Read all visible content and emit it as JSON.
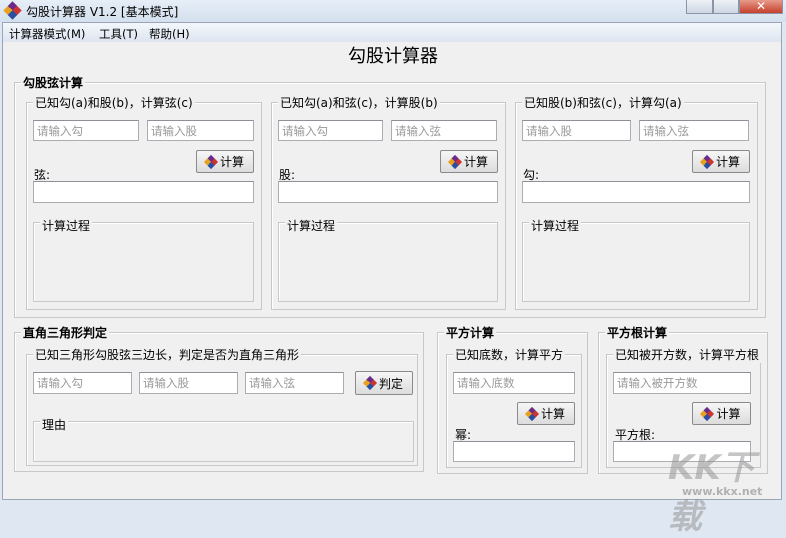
{
  "window": {
    "title": "勾股计算器 V1.2 [基本模式]",
    "close_label": "✕"
  },
  "menu": [
    "计算器模式(M)",
    "工具(T)",
    "帮助(H)"
  ],
  "main_title": "勾股计算器",
  "pythag": {
    "title": "勾股弦计算",
    "panels": [
      {
        "title": "已知勾(a)和股(b)，计算弦(c)",
        "ph1": "请输入勾",
        "ph2": "请输入股",
        "button": "计算",
        "result_label": "弦:",
        "process_label": "计算过程"
      },
      {
        "title": "已知勾(a)和弦(c)，计算股(b)",
        "ph1": "请输入勾",
        "ph2": "请输入弦",
        "button": "计算",
        "result_label": "股:",
        "process_label": "计算过程"
      },
      {
        "title": "已知股(b)和弦(c)，计算勾(a)",
        "ph1": "请输入股",
        "ph2": "请输入弦",
        "button": "计算",
        "result_label": "勾:",
        "process_label": "计算过程"
      }
    ]
  },
  "right_triangle": {
    "title": "直角三角形判定",
    "subtitle": "已知三角形勾股弦三边长，判定是否为直角三角形",
    "ph1": "请输入勾",
    "ph2": "请输入股",
    "ph3": "请输入弦",
    "button": "判定",
    "reason_label": "理由"
  },
  "square": {
    "title": "平方计算",
    "subtitle": "已知底数，计算平方",
    "placeholder": "请输入底数",
    "button": "计算",
    "result_label": "幂:"
  },
  "sqrt": {
    "title": "平方根计算",
    "subtitle": "已知被开方数，计算平方根",
    "placeholder": "请输入被开方数",
    "button": "计算",
    "result_label": "平方根:"
  },
  "watermark": {
    "logo": "KK下载",
    "url": "www.kkx.net"
  }
}
